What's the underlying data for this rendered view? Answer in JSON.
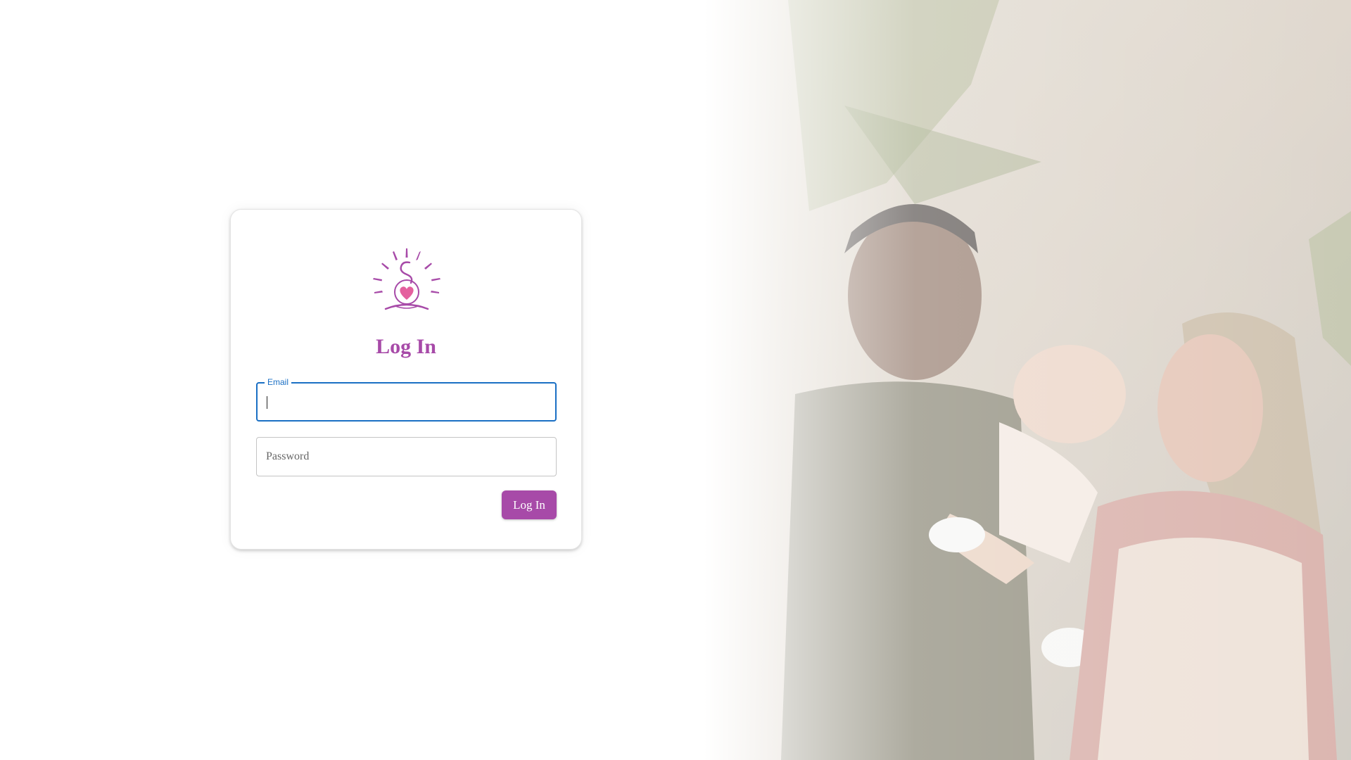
{
  "login": {
    "title": "Log In",
    "email": {
      "label": "Email",
      "value": "",
      "placeholder": ""
    },
    "password": {
      "placeholder": "Password",
      "value": ""
    },
    "submit_label": "Log In"
  },
  "icons": {
    "logo": "sun-figure-heart-logo"
  },
  "colors": {
    "brand": "#a74aa8",
    "focus": "#1a6fc4",
    "heart": "#e4609e"
  }
}
